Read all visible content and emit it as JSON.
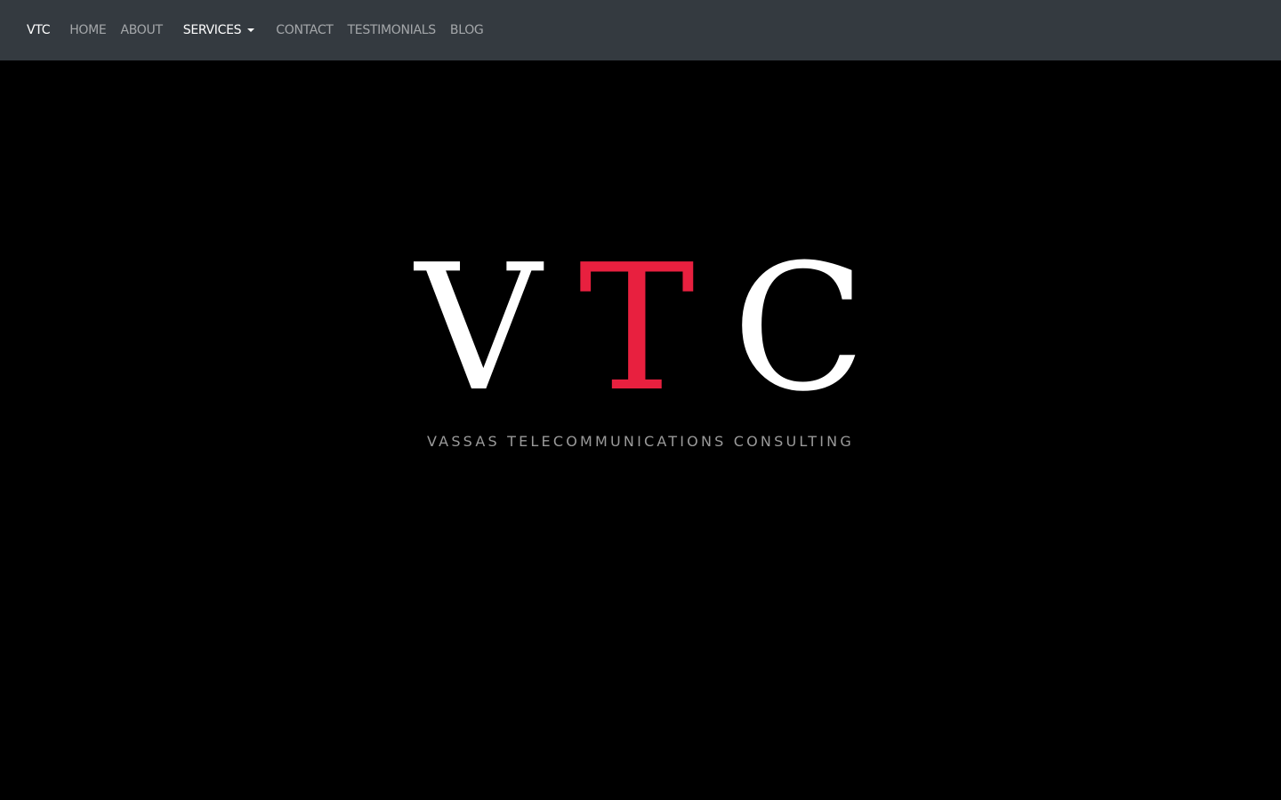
{
  "navbar": {
    "brand": "VTC",
    "links": [
      {
        "label": "HOME"
      },
      {
        "label": "ABOUT"
      },
      {
        "label": "SERVICES"
      },
      {
        "label": "CONTACT"
      },
      {
        "label": "TESTIMONIALS"
      },
      {
        "label": "BLOG"
      }
    ],
    "background_color": "#343a40"
  },
  "hero": {
    "logo_letters": [
      "V",
      "T",
      "C"
    ],
    "accent_color": "#e8203f",
    "tagline": "VASSAS TELECOMMUNICATIONS CONSULTING"
  }
}
